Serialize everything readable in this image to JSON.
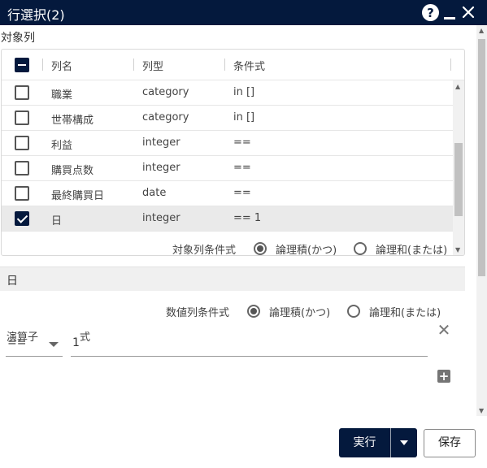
{
  "window": {
    "title": "行選択(2)"
  },
  "target_columns": {
    "label": "対象列",
    "headers": {
      "name": "列名",
      "type": "列型",
      "condition": "条件式"
    },
    "rows": [
      {
        "name": "職業",
        "type": "category",
        "condition": "in []",
        "checked": false
      },
      {
        "name": "世帯構成",
        "type": "category",
        "condition": "in []",
        "checked": false
      },
      {
        "name": "利益",
        "type": "integer",
        "condition": "==",
        "checked": false
      },
      {
        "name": "購買点数",
        "type": "integer",
        "condition": "==",
        "checked": false
      },
      {
        "name": "最終購買日",
        "type": "date",
        "condition": "==",
        "checked": false
      },
      {
        "name": "日",
        "type": "integer",
        "condition": "== 1",
        "checked": true
      }
    ],
    "condition_label": "対象列条件式",
    "option_and": "論理積(かつ)",
    "option_or": "論理和(または)",
    "selected": "and"
  },
  "detail": {
    "column_name": "日",
    "condition_label": "数値列条件式",
    "option_and": "論理積(かつ)",
    "option_or": "論理和(または)",
    "selected": "and",
    "operator_header": "演算子",
    "expression_header": "式",
    "operator_value": "==",
    "expression_value": "1"
  },
  "footer": {
    "run_label": "実行",
    "save_label": "保存"
  },
  "colors": {
    "primary": "#04193d"
  }
}
